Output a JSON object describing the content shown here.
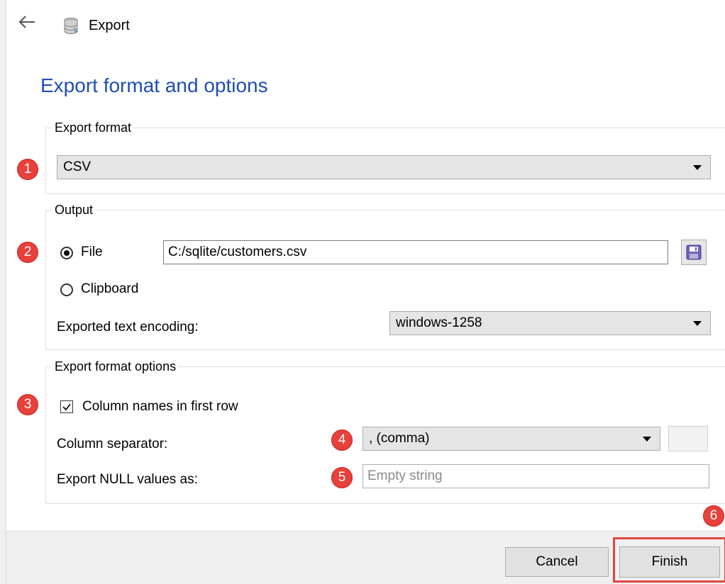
{
  "window": {
    "title": "Export"
  },
  "page": {
    "heading": "Export format and options"
  },
  "export_format": {
    "legend": "Export format",
    "selected": "CSV"
  },
  "output": {
    "legend": "Output",
    "file_label": "File",
    "file_path": "C:/sqlite/customers.csv",
    "clipboard_label": "Clipboard",
    "encoding_label": "Exported text encoding:",
    "encoding_value": "windows-1258",
    "file_selected": true
  },
  "format_options": {
    "legend": "Export format options",
    "column_names_label": "Column names in first row",
    "column_names_checked": true,
    "separator_label": "Column separator:",
    "separator_value": ", (comma)",
    "null_label": "Export NULL values as:",
    "null_placeholder": "Empty string"
  },
  "footer": {
    "cancel_label": "Cancel",
    "finish_label": "Finish"
  },
  "badges": [
    "1",
    "2",
    "3",
    "4",
    "5",
    "6"
  ],
  "colors": {
    "heading": "#1f4db5",
    "badge": "#e8403a",
    "highlight": "#e0473f"
  },
  "icons": {
    "back": "back-arrow-icon",
    "app": "database-icon",
    "save": "floppy-disk-icon",
    "dropdown": "chevron-down-icon"
  }
}
